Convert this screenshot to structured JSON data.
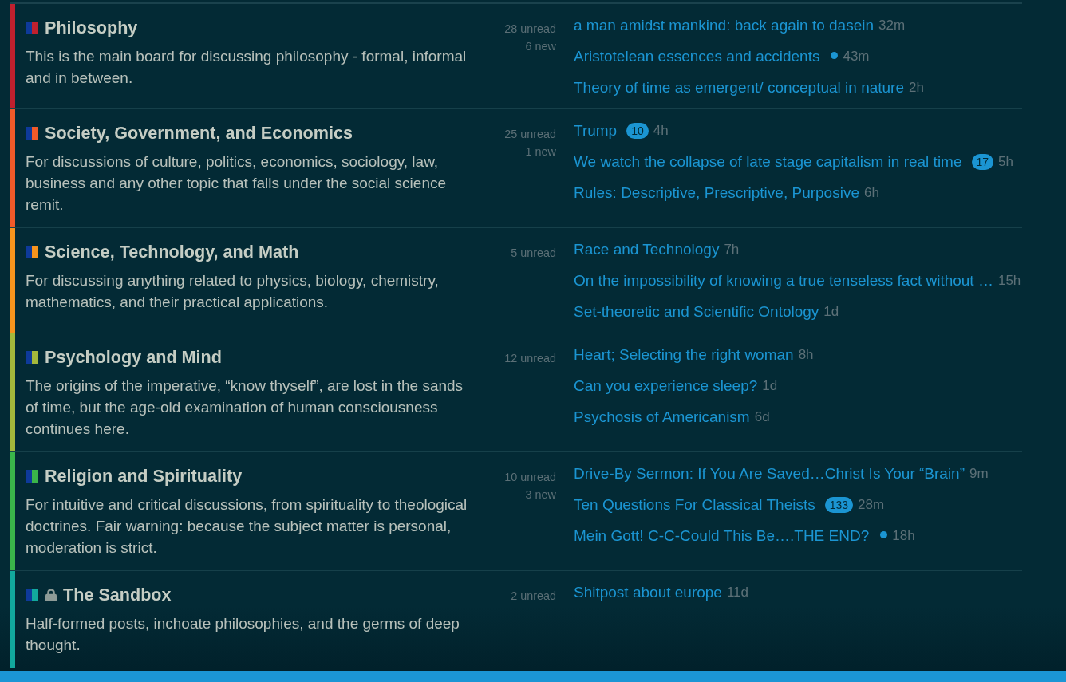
{
  "categories": [
    {
      "name": "Philosophy",
      "color": "#c0202e",
      "locked": false,
      "description": "This is the main board for discussing philosophy - formal, informal and in between.",
      "unread": "28 unread",
      "new": "6 new",
      "topics": [
        {
          "title": "a man amidst mankind: back again to dasein",
          "unread_dot": false,
          "time": "32m"
        },
        {
          "title": "Aristotelean essences and accidents",
          "unread_dot": true,
          "time": "43m"
        },
        {
          "title": "Theory of time as emergent/ conceptual in nature",
          "unread_dot": false,
          "time": "2h"
        }
      ]
    },
    {
      "name": "Society, Government, and Economics",
      "color": "#f15a29",
      "locked": false,
      "description": "For discussions of culture, politics, economics, sociology, law, business and any other topic that falls under the social science remit.",
      "unread": "25 unread",
      "new": "1 new",
      "topics": [
        {
          "title": "Trump",
          "badge": "10",
          "unread_dot": false,
          "time": "4h"
        },
        {
          "title": "We watch the collapse of late stage capitalism in real time",
          "badge": "17",
          "unread_dot": false,
          "time": "5h"
        },
        {
          "title": "Rules: Descriptive, Prescriptive, Purposive",
          "unread_dot": false,
          "time": "6h"
        }
      ]
    },
    {
      "name": "Science, Technology, and Math",
      "color": "#f7941d",
      "locked": false,
      "description": "For discussing anything related to physics, biology, chemistry, mathematics, and their practical applications.",
      "unread": "5 unread",
      "topics": [
        {
          "title": "Race and Technology",
          "unread_dot": false,
          "time": "7h"
        },
        {
          "title": "On the impossibility of knowing a true tenseless fact without …",
          "unread_dot": false,
          "time": "15h"
        },
        {
          "title": "Set-theoretic and Scientific Ontology",
          "unread_dot": false,
          "time": "1d"
        }
      ]
    },
    {
      "name": "Psychology and Mind",
      "color": "#a4b83b",
      "locked": false,
      "description": "The origins of the imperative, “know thyself”, are lost in the sands of time, but the age-old examination of human consciousness continues here.",
      "unread": "12 unread",
      "topics": [
        {
          "title": "Heart; Selecting the right woman",
          "unread_dot": false,
          "time": "8h"
        },
        {
          "title": "Can you experience sleep?",
          "unread_dot": false,
          "time": "1d"
        },
        {
          "title": "Psychosis of Americanism",
          "unread_dot": false,
          "time": "6d"
        }
      ]
    },
    {
      "name": "Religion and Spirituality",
      "color": "#3ab54a",
      "locked": false,
      "description": "For intuitive and critical discussions, from spirituality to theological doctrines. Fair warning: because the subject matter is personal, moderation is strict.",
      "unread": "10 unread",
      "new": "3 new",
      "topics": [
        {
          "title": "Drive-By Sermon: If You Are Saved…Christ Is Your “Brain”",
          "unread_dot": false,
          "time": "9m"
        },
        {
          "title": "Ten Questions For Classical Theists",
          "badge": "133",
          "unread_dot": false,
          "time": "28m"
        },
        {
          "title": "Mein Gott! C-C-Could This Be….THE END?",
          "unread_dot": true,
          "time": "18h"
        }
      ]
    },
    {
      "name": "The Sandbox",
      "color": "#12a89d",
      "locked": true,
      "description": "Half-formed posts, inchoate philosophies, and the germs of deep thought.",
      "unread": "2 unread",
      "topics": [
        {
          "title": "Shitpost about europe",
          "unread_dot": false,
          "time": "11d"
        }
      ]
    }
  ]
}
